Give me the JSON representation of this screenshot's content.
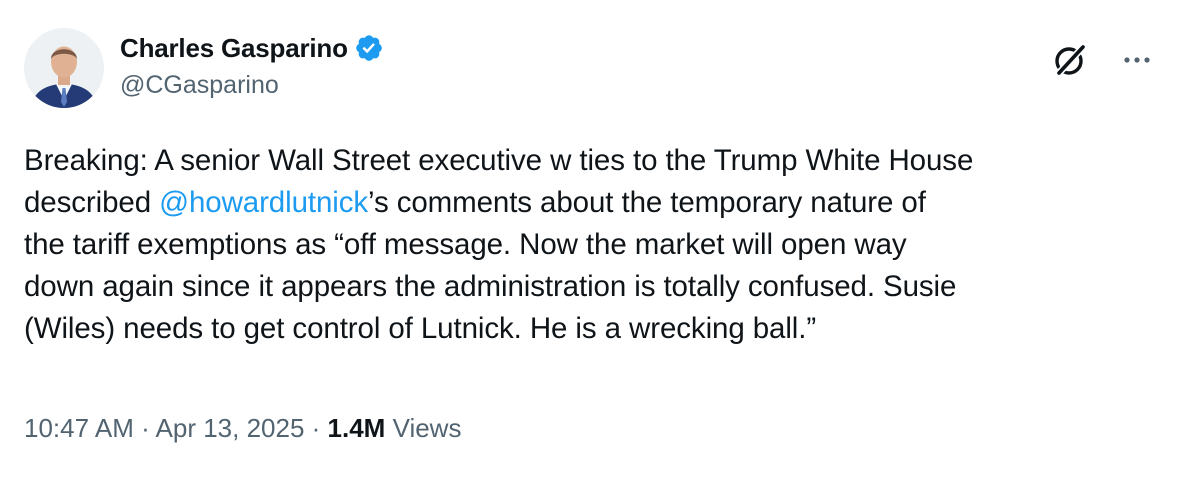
{
  "author": {
    "display_name": "Charles Gasparino",
    "handle": "@CGasparino",
    "verified": true
  },
  "icons": {
    "avatar": "profile-photo",
    "verified": "verified-badge-icon",
    "grok": "grok-icon",
    "more": "more-options-icon"
  },
  "tweet": {
    "lines": [
      [
        {
          "text": "Breaking: A senior Wall Street executive w ties to the Trump White House"
        }
      ],
      [
        {
          "text": "described "
        },
        {
          "text": "@howardlutnick",
          "mention": true
        },
        {
          "text": "’s comments about the temporary nature of"
        }
      ],
      [
        {
          "text": "the tariff exemptions as “off message. Now the market will open way"
        }
      ],
      [
        {
          "text": "down again since it appears the administration is totally confused. Susie"
        }
      ],
      [
        {
          "text": "(Wiles) needs to get control of Lutnick. He is a wrecking ball.”"
        }
      ]
    ]
  },
  "meta": {
    "time": "10:47 AM",
    "separator": " · ",
    "date": "Apr 13, 2025",
    "views_count": "1.4M",
    "views_label": " Views"
  },
  "colors": {
    "text": "#0f1419",
    "secondary": "#536471",
    "accent": "#1d9bf0"
  }
}
